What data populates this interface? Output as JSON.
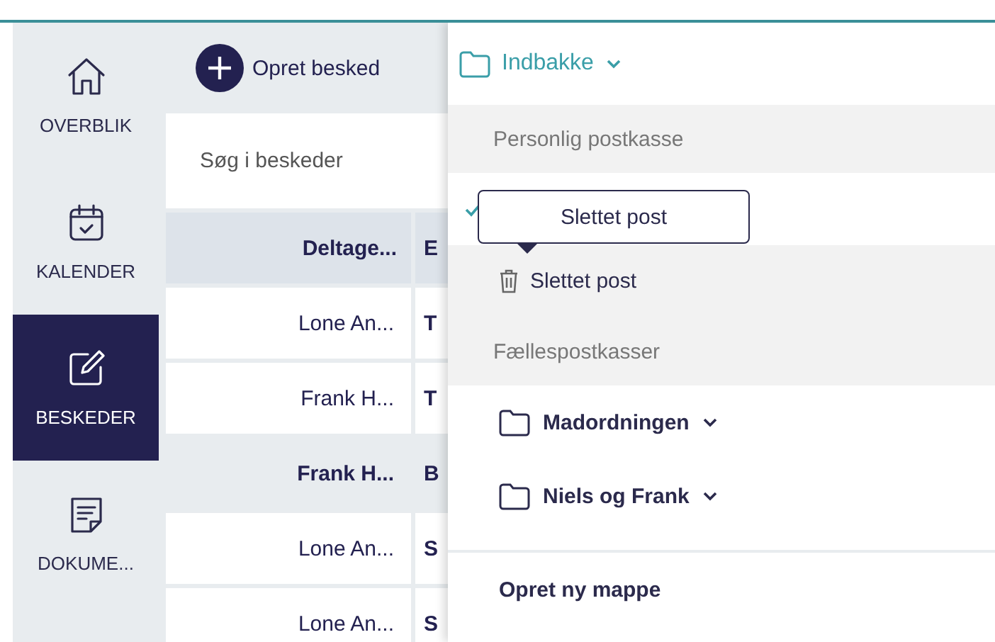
{
  "nav": [
    {
      "label": "OVERBLIK",
      "selected": false
    },
    {
      "label": "KALENDER",
      "selected": false
    },
    {
      "label": "BESKEDER",
      "selected": true
    },
    {
      "label": "DOKUME...",
      "selected": false
    }
  ],
  "toolbar": {
    "new_message": "Opret besked"
  },
  "search": {
    "placeholder": "Søg i beskeder"
  },
  "table": {
    "columns": [
      "Deltage...",
      "E"
    ],
    "rows": [
      {
        "cells": [
          "Lone An...",
          "T"
        ],
        "unread": false
      },
      {
        "cells": [
          "Frank H...",
          "T"
        ],
        "unread": false
      },
      {
        "cells": [
          "Frank H...",
          "B"
        ],
        "unread": true
      },
      {
        "cells": [
          "Lone An...",
          "S"
        ],
        "unread": false
      },
      {
        "cells": [
          "Lone An...",
          "S"
        ],
        "unread": false
      }
    ]
  },
  "folder_menu": {
    "current": "Indbakke",
    "sections": [
      {
        "title": "Personlig postkasse",
        "items": [
          {
            "kind": "covered",
            "selected": true
          },
          {
            "kind": "trash",
            "label": "Slettet post",
            "selected": false
          }
        ]
      },
      {
        "title": "Fællespostkasser",
        "items": [
          {
            "kind": "folder",
            "label": "Madordningen",
            "selected": false
          },
          {
            "kind": "folder",
            "label": "Niels og Frank",
            "selected": false
          }
        ]
      }
    ],
    "create_folder": "Opret ny mappe"
  },
  "tooltip": "Slettet post"
}
